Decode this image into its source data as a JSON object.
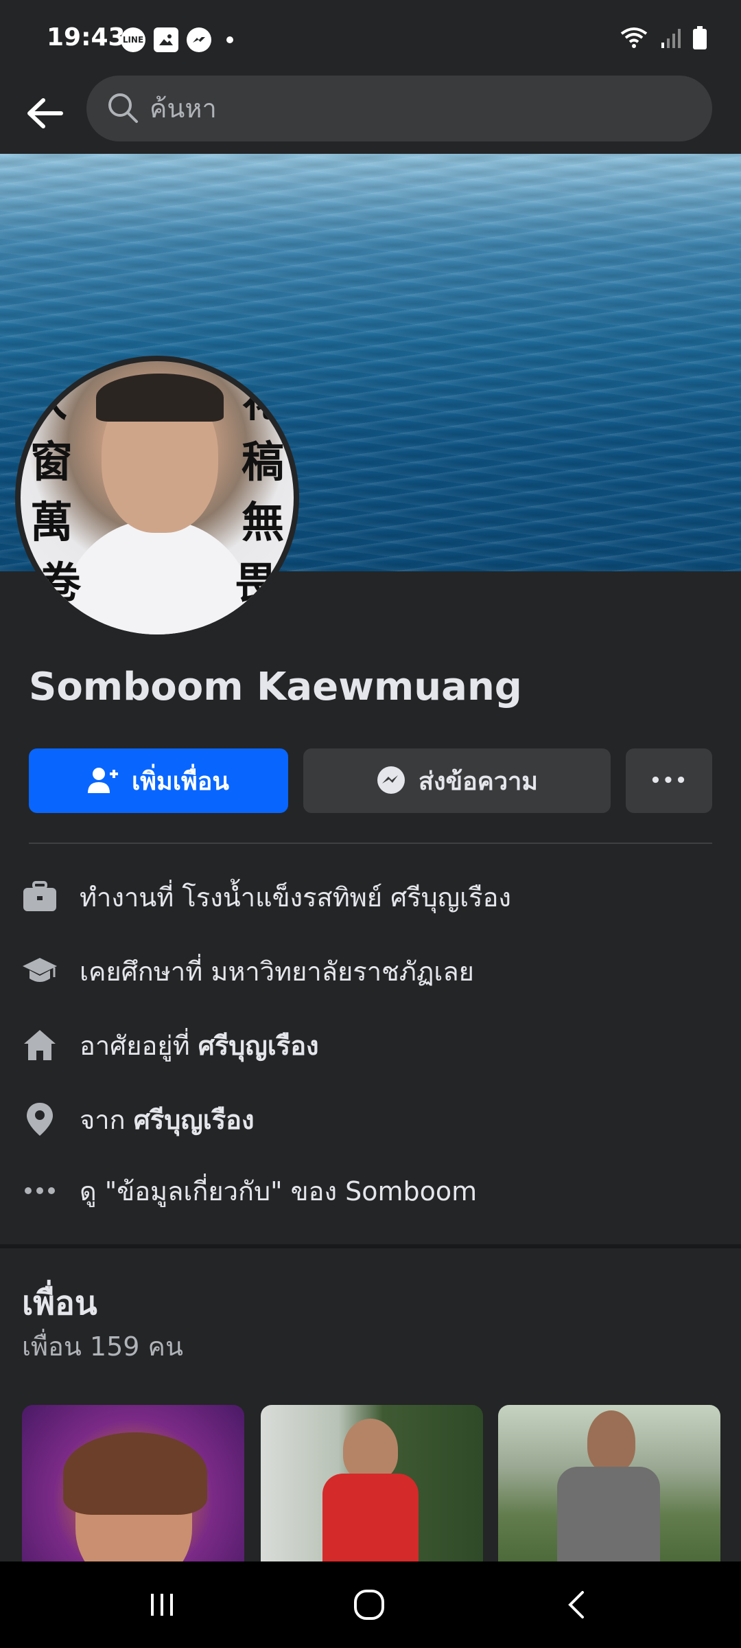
{
  "status_bar": {
    "time": "19:43",
    "icons_left": [
      "line-icon",
      "gallery-icon",
      "messenger-icon"
    ],
    "icons_right": [
      "wifi-icon",
      "signal-icon",
      "battery-icon"
    ],
    "line_label": "LINE"
  },
  "search": {
    "placeholder": "ค้นหา"
  },
  "profile": {
    "name": "Somboom Kaewmuang",
    "avatar_glyphs_left": [
      "入",
      "窗",
      "萬",
      "卷"
    ],
    "avatar_glyphs_right": [
      "花",
      "稿",
      "無",
      "畏"
    ]
  },
  "actions": {
    "add_friend_label": "เพิ่มเพื่อน",
    "message_label": "ส่งข้อความ",
    "more_label": "•••"
  },
  "intro": {
    "work_prefix": "ทำงานที่ ",
    "work_place": "โรงน้ำแข็งรสทิพย์ ศรีบุญเรือง",
    "edu_prefix": "เคยศึกษาที่ ",
    "edu_place": "มหาวิทยาลัยราชภัฏเลย",
    "lives_prefix": "อาศัยอยู่ที่ ",
    "lives_place": "ศรีบุญเรือง",
    "from_prefix": "จาก ",
    "from_place": "ศรีบุญเรือง",
    "about_link": "ดู \"ข้อมูลเกี่ยวกับ\" ของ Somboom"
  },
  "friends": {
    "title": "เพื่อน",
    "count_text": "เพื่อน 159 คน"
  },
  "colors": {
    "background": "#242526",
    "primary_button": "#0866ff",
    "secondary_button": "#3a3b3c"
  }
}
